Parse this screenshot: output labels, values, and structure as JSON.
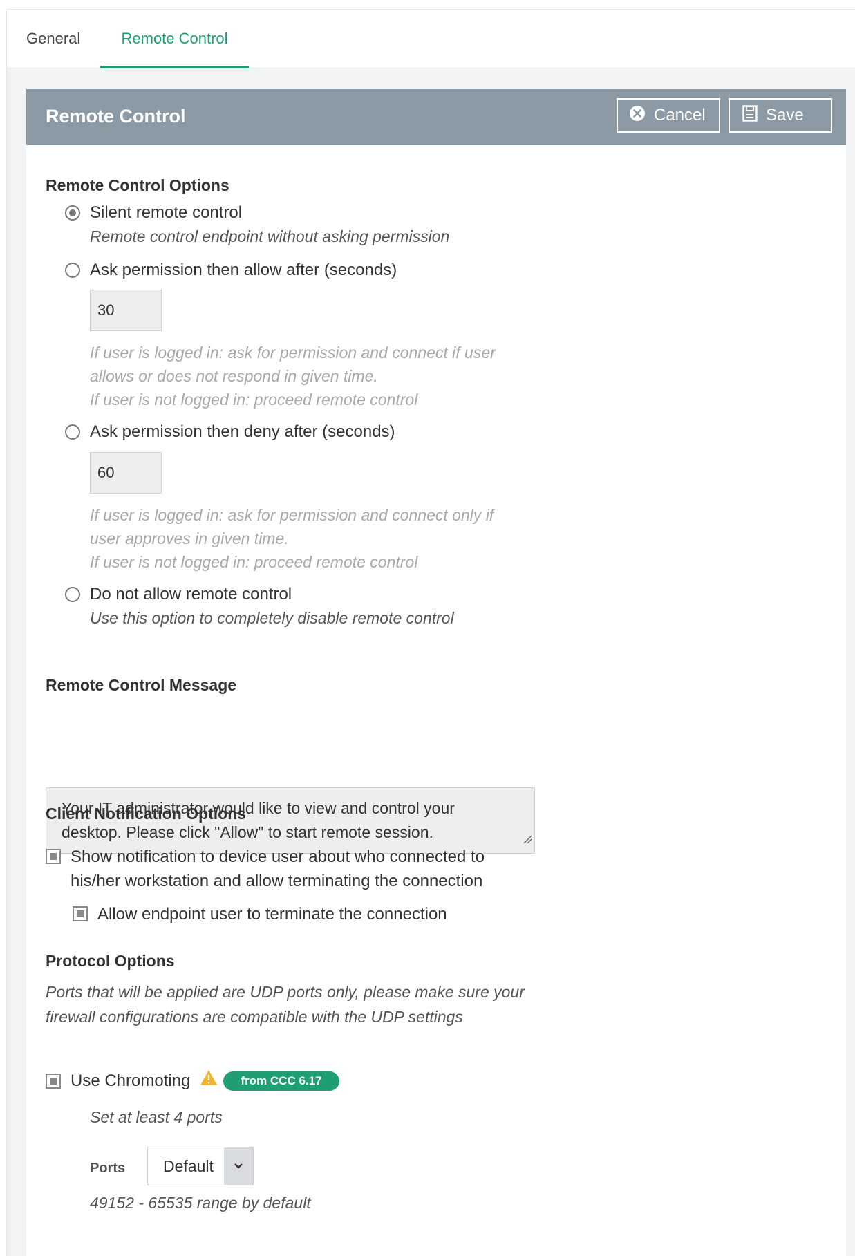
{
  "tabs": [
    {
      "label": "General",
      "active": false
    },
    {
      "label": "Remote Control",
      "active": true
    }
  ],
  "panel": {
    "title": "Remote Control",
    "cancel_label": "Cancel",
    "save_label": "Save"
  },
  "remote_options": {
    "title": "Remote Control Options",
    "options": [
      {
        "label": "Silent remote control",
        "description": "Remote control endpoint without asking permission",
        "selected": true
      },
      {
        "label": "Ask permission then allow after (seconds)",
        "value": "30",
        "hint_lines": [
          "If user is logged in: ask for permission and connect if user",
          "allows or does not respond in given time.",
          "If user is not logged in: proceed remote control"
        ],
        "selected": false
      },
      {
        "label": "Ask permission then deny after (seconds)",
        "value": "60",
        "hint_lines": [
          "If user is logged in: ask for permission and connect only if",
          "user approves in given time.",
          "If user is not logged in: proceed remote control"
        ],
        "selected": false
      },
      {
        "label": "Do not allow remote control",
        "description": "Use this option to completely disable remote control",
        "selected": false
      }
    ]
  },
  "message": {
    "title": "Remote Control Message",
    "text": "Your IT administrator would like to view and control your desktop. Please click \"Allow\" to start remote session."
  },
  "notifications": {
    "title": "Client Notification Options",
    "show_notification_label": "Show notification to device user about who connected to his/her workstation and allow terminating the connection",
    "show_notification_checked": true,
    "allow_terminate_label": "Allow endpoint user to terminate the connection",
    "allow_terminate_checked": true
  },
  "protocol": {
    "title": "Protocol Options",
    "note": "Ports that will be applied are UDP ports only, please make sure your firewall configurations are compatible with the UDP settings",
    "chromoting_label": "Use Chromoting",
    "chromoting_checked": true,
    "badge": "from CCC 6.17",
    "min_ports_note": "Set at least 4 ports",
    "ports_label": "Ports",
    "ports_value": "Default",
    "range_note": "49152 - 65535 range by default"
  },
  "colors": {
    "accent": "#1e9e72",
    "header_bg": "#8c9aa6",
    "warning": "#f0b429"
  },
  "icons": {
    "cancel": "close-circle-icon",
    "save": "floppy-disk-icon",
    "warning": "warning-triangle-icon",
    "dropdown": "chevron-down-icon"
  }
}
